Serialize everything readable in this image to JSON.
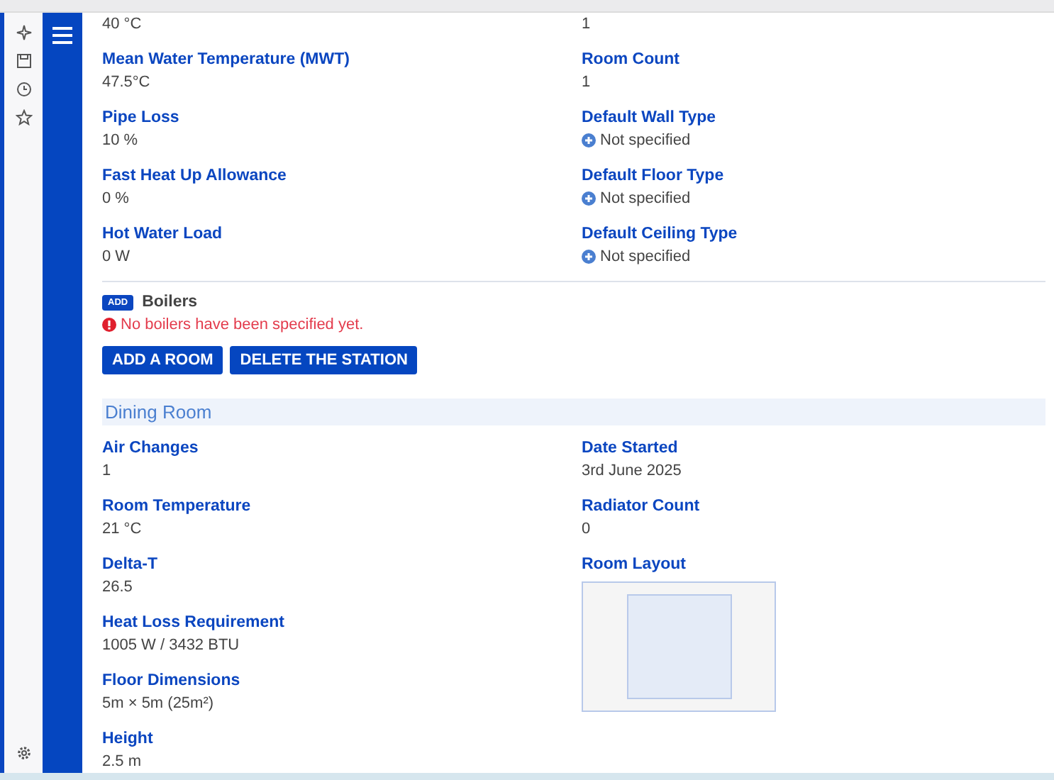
{
  "station": {
    "left": [
      {
        "value": "40 °C"
      },
      {
        "label": "Mean Water Temperature (MWT)",
        "value": "47.5°C"
      },
      {
        "label": "Pipe Loss",
        "value": "10 %"
      },
      {
        "label": "Fast Heat Up Allowance",
        "value": "0 %"
      },
      {
        "label": "Hot Water Load",
        "value": "0 W"
      }
    ],
    "right": [
      {
        "value": "1",
        "kind": "text"
      },
      {
        "label": "Room Count",
        "value": "1",
        "kind": "text"
      },
      {
        "label": "Default Wall Type",
        "value": "Not specified",
        "kind": "unset"
      },
      {
        "label": "Default Floor Type",
        "value": "Not specified",
        "kind": "unset"
      },
      {
        "label": "Default Ceiling Type",
        "value": "Not specified",
        "kind": "unset"
      }
    ]
  },
  "boilers": {
    "badge": "ADD",
    "title": "Boilers",
    "error": "No boilers have been specified yet."
  },
  "buttons": [
    "ADD A ROOM",
    "DELETE THE STATION"
  ],
  "room": {
    "name": "Dining Room",
    "left": [
      {
        "label": "Air Changes",
        "value": "1"
      },
      {
        "label": "Room Temperature",
        "value": "21 °C"
      },
      {
        "label": "Delta-T",
        "value": "26.5"
      },
      {
        "label": "Heat Loss Requirement",
        "value": "1005 W / 3432 BTU"
      },
      {
        "label": "Floor Dimensions",
        "value": "5m × 5m (25m²)"
      },
      {
        "label": "Height",
        "value": "2.5 m"
      }
    ],
    "right": [
      {
        "label": "Date Started",
        "value": "3rd June 2025",
        "kind": "text"
      },
      {
        "label": "Radiator Count",
        "value": "0",
        "kind": "text"
      },
      {
        "label": "Room Layout",
        "kind": "layout"
      }
    ]
  }
}
